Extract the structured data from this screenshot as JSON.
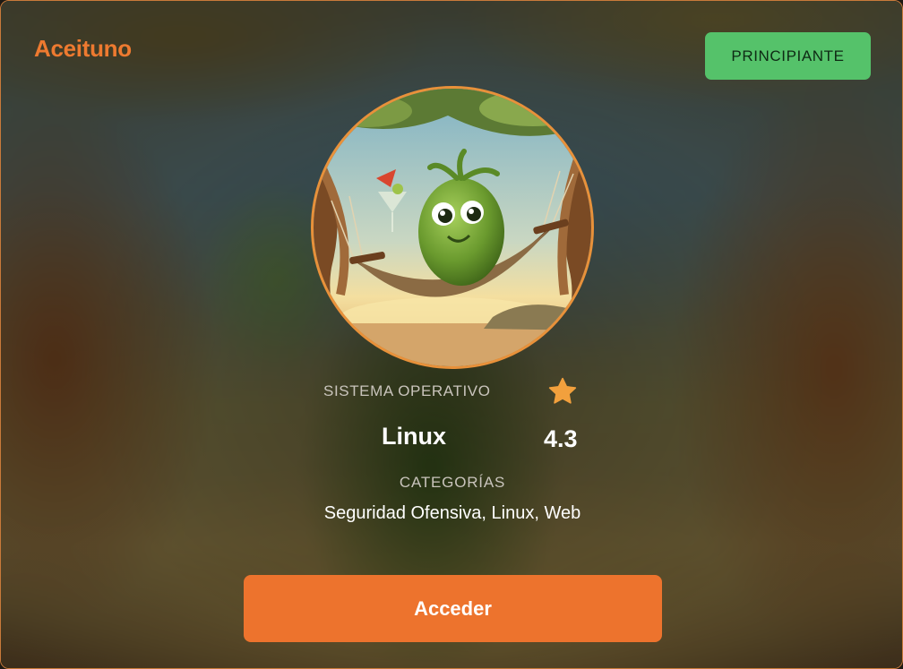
{
  "card": {
    "title": "Aceituno",
    "level_badge": "PRINCIPIANTE",
    "avatar_icon": "olive-hammock-illustration",
    "os_label": "SISTEMA OPERATIVO",
    "os_value": "Linux",
    "rating_icon": "star-icon",
    "rating_value": "4.3",
    "categories_label": "CATEGORÍAS",
    "categories_value": "Seguridad Ofensiva, Linux, Web",
    "access_button_label": "Acceder"
  },
  "colors": {
    "accent": "#ed732d",
    "title": "#ee7a30",
    "badge_green": "#55c26a",
    "star": "#f2a03d",
    "border": "#c97a3a"
  }
}
